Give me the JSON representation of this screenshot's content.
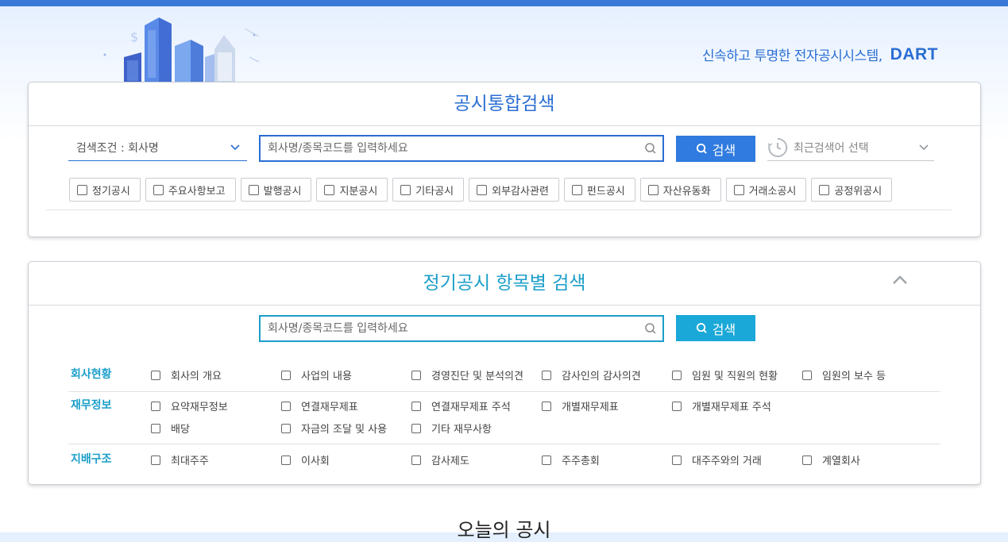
{
  "header": {
    "slogan": "신속하고 투명한 전자공시시스템,",
    "logo_text": "DART"
  },
  "integrated_search": {
    "title": "공시통합검색",
    "condition_select": "검색조건 : 회사명",
    "search_placeholder": "회사명/종목코드를 입력하세요",
    "search_button": "검색",
    "recent_label": "최근검색어 선택",
    "disclosure_types": [
      "정기공시",
      "주요사항보고",
      "발행공시",
      "지분공시",
      "기타공시",
      "외부감사관련",
      "펀드공시",
      "자산유동화",
      "거래소공시",
      "공정위공시"
    ]
  },
  "item_search": {
    "title": "정기공시 항목별 검색",
    "search_placeholder": "회사명/종목코드를 입력하세요",
    "search_button": "검색",
    "categories": [
      {
        "label": "회사현황",
        "items": [
          "회사의 개요",
          "사업의 내용",
          "경영진단 및 분석의견",
          "감사인의 감사의견",
          "임원 및 직원의 현황",
          "임원의 보수 등"
        ]
      },
      {
        "label": "재무정보",
        "items": [
          "요약재무정보",
          "연결재무제표",
          "연결재무제표 주석",
          "개별재무제표",
          "개별재무제표 주석",
          "배당",
          "자금의 조달 및 사용",
          "기타 재무사항"
        ]
      },
      {
        "label": "지배구조",
        "items": [
          "최대주주",
          "이사회",
          "감사제도",
          "주주총회",
          "대주주와의 거래",
          "계열회사"
        ]
      }
    ]
  },
  "today_section": {
    "title": "오늘의 공시"
  },
  "colors": {
    "primary_blue": "#2a6ed3",
    "accent_cyan": "#1a9ec9",
    "top_bar": "#3a78d8"
  },
  "icons": [
    "search-icon",
    "chevron-down-icon",
    "clock-icon",
    "chevron-up-icon",
    "checkbox-icon",
    "city-illustration"
  ]
}
